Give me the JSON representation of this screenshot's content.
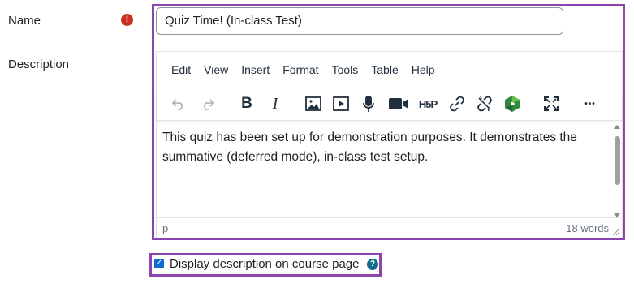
{
  "fields": {
    "name_label": "Name",
    "description_label": "Description",
    "required_icon_glyph": "!"
  },
  "name_input": {
    "value": "Quiz Time! (In-class Test)"
  },
  "editor": {
    "menu": [
      "Edit",
      "View",
      "Insert",
      "Format",
      "Tools",
      "Table",
      "Help"
    ],
    "toolbar_icons": [
      "undo-icon",
      "redo-icon",
      "bold-icon",
      "italic-icon",
      "image-icon",
      "media-icon",
      "record-audio-icon",
      "record-video-icon",
      "h5p-icon",
      "link-icon",
      "unlink-icon",
      "panopto-icon",
      "fullscreen-icon",
      "more-icon"
    ],
    "bold_glyph": "B",
    "italic_glyph": "I",
    "h5p_glyph": "H5P",
    "more_glyph": "•••",
    "content": "This quiz has been set up for demonstration purposes. It demonstrates the summative (deferred mode), in-class test setup.",
    "status_path": "p",
    "word_count": "18 words"
  },
  "display_description": {
    "label": "Display description on course page",
    "checked": true,
    "help_glyph": "?"
  },
  "colors": {
    "highlight": "#8e44ad",
    "required": "#ca3120",
    "checkbox": "#0b6bd3",
    "help": "#0f6e8c"
  }
}
